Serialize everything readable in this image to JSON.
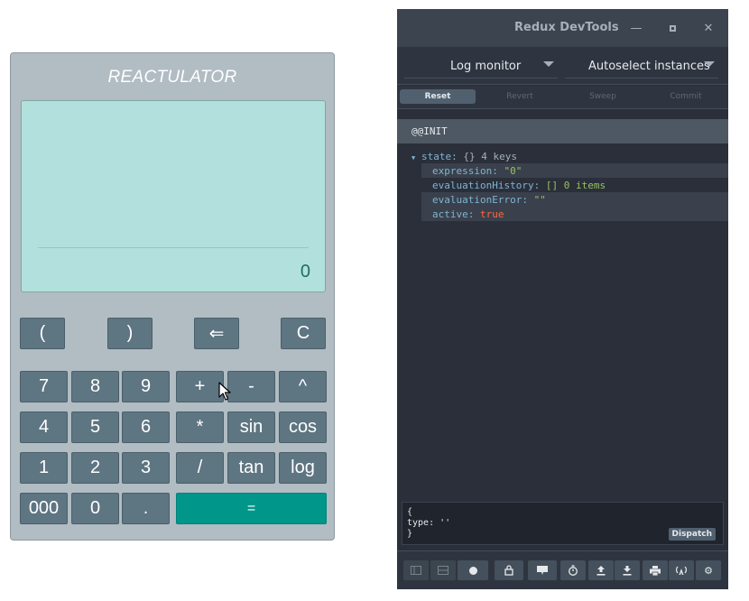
{
  "calculator": {
    "title": "REACTULATOR",
    "display_value": "0",
    "buttons": {
      "paren_open": "(",
      "paren_close": ")",
      "backspace": "⇐",
      "clear": "C",
      "seven": "7",
      "eight": "8",
      "nine": "9",
      "plus": "+",
      "minus": "-",
      "power": "^",
      "four": "4",
      "five": "5",
      "six": "6",
      "multiply": "*",
      "sin": "sin",
      "cos": "cos",
      "one": "1",
      "two": "2",
      "three": "3",
      "divide": "/",
      "tan": "tan",
      "log": "log",
      "triple_zero": "000",
      "zero": "0",
      "dot": ".",
      "equals": "="
    }
  },
  "devtools": {
    "window_title": "Redux DevTools",
    "monitor_select": "Log monitor",
    "instance_select": "Autoselect instances",
    "actions": {
      "reset": "Reset",
      "revert": "Revert",
      "sweep": "Sweep",
      "commit": "Commit"
    },
    "log": {
      "action_type": "@@INIT",
      "state_key": "state:",
      "state_type": "{}",
      "state_count": "4 keys",
      "items": [
        {
          "key": "expression:",
          "value": "\"0\""
        },
        {
          "key": "evaluationHistory:",
          "value": "[]",
          "extra": "0 items"
        },
        {
          "key": "evaluationError:",
          "value": "\"\""
        },
        {
          "key": "active:",
          "value": "true"
        }
      ]
    },
    "dispatcher": {
      "text": "{\ntype: ''\n}",
      "button": "Dispatch"
    }
  },
  "colors": {
    "calc_bg": "#b1bcc3",
    "screen_bg": "#b2e1dd",
    "button_bg": "#5e7582",
    "equals_bg": "#00968a",
    "devtools_bg": "#2a2f3a"
  }
}
